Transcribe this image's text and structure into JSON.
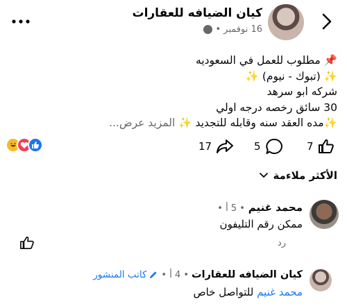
{
  "header": {
    "page_name": "كيان الضيافه للعقارات",
    "post_date": "16 نوفمبر",
    "separator": "•"
  },
  "post": {
    "lines": [
      "📌 مطلوب للعمل في السعوديه",
      "✨ (تبوك - نيوم) ✨",
      "شركه ابو سرهد",
      "30 سائق رخصه درجه اولي",
      "✨مده العقد سنه وقابله للتجديد ✨"
    ],
    "see_more": "المزيد عرض..."
  },
  "stats": {
    "likes": "7",
    "comments": "5",
    "shares": "17"
  },
  "sort": {
    "label": "الأكثر ملاءمة"
  },
  "comments": [
    {
      "name": "محمد غنيم",
      "meta": "• 5 أ •",
      "text": "ممكن رقم التليفون",
      "reply_label": "رد"
    },
    {
      "name": "كيان  الضيافه للعقارات",
      "meta": "• 4 أ •",
      "author_badge": "كاتب المنشور",
      "mention": "محمد غنيم",
      "text": " للتواصل خاص"
    }
  ],
  "colors": {
    "accent": "#1877f2",
    "meta_gray": "#65676b"
  }
}
